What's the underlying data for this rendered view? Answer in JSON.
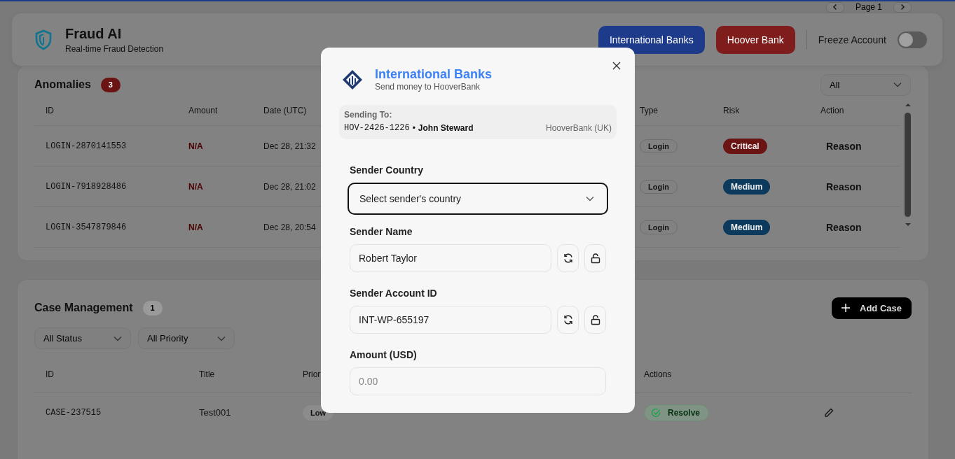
{
  "pager": {
    "label": "Page 1"
  },
  "header": {
    "title": "Fraud AI",
    "subtitle": "Real-time Fraud Detection",
    "buttons": [
      {
        "label": "International Banks",
        "kind": "primary"
      },
      {
        "label": "Hoover Bank",
        "kind": "danger"
      }
    ],
    "freeze": {
      "label": "Freeze Account",
      "on": false
    }
  },
  "anomalies": {
    "title": "Anomalies",
    "count": "3",
    "filter": "All",
    "columns": [
      "ID",
      "Amount",
      "Date (UTC)",
      "Type",
      "Risk",
      "Action"
    ],
    "rows": [
      {
        "id": "LOGIN-2870141553",
        "amount": "N/A",
        "date": "Dec 28, 21:32",
        "type": "Login",
        "risk": {
          "label": "Critical",
          "kind": "critical"
        },
        "action": "Reason"
      },
      {
        "id": "LOGIN-7918928486",
        "amount": "N/A",
        "date": "Dec 28, 21:02",
        "type": "Login",
        "risk": {
          "label": "Medium",
          "kind": "medium"
        },
        "action": "Reason"
      },
      {
        "id": "LOGIN-3547879846",
        "amount": "N/A",
        "date": "Dec 28, 20:54",
        "type": "Login",
        "risk": {
          "label": "Medium",
          "kind": "medium"
        },
        "action": "Reason"
      }
    ]
  },
  "cases": {
    "title": "Case Management",
    "count": "1",
    "add_button": "Add Case",
    "filters": [
      "All Status",
      "All Priority"
    ],
    "columns": [
      "ID",
      "Title",
      "Prior",
      "Actions"
    ],
    "rows": [
      {
        "id": "CASE-237515",
        "title": "Test001",
        "priority": "Low",
        "action": "Resolve"
      }
    ]
  },
  "modal": {
    "title": "International Banks",
    "subtitle": "Send money to HooverBank",
    "recipient": {
      "label": "Sending To:",
      "account": "HOV-2426-1226",
      "separator": "•",
      "name": "John Steward",
      "bank": "HooverBank (UK)"
    },
    "fields": [
      {
        "label": "Sender Country",
        "kind": "select",
        "placeholder": "Select sender's country",
        "focused": true
      },
      {
        "label": "Sender Name",
        "kind": "locked",
        "value": "Robert Taylor",
        "focused": false
      },
      {
        "label": "Sender Account ID",
        "kind": "locked",
        "value": "INT-WP-655197",
        "focused": false
      },
      {
        "label": "Amount (USD)",
        "kind": "text",
        "placeholder": "0.00",
        "focused": false
      }
    ]
  }
}
